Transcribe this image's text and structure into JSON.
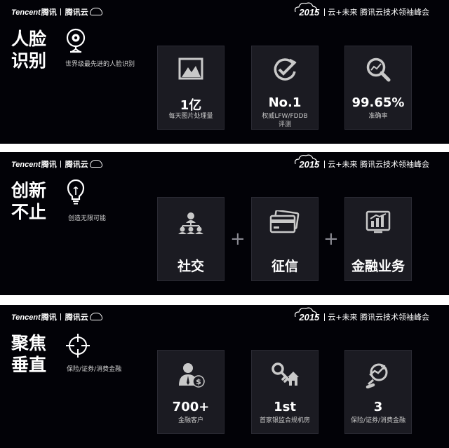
{
  "brand": {
    "tencent": "Tencent",
    "tengxun": "腾讯",
    "cloud": "腾讯云"
  },
  "event": {
    "year": "2015",
    "text": "云+未来 腾讯云技术领袖峰会"
  },
  "slides": [
    {
      "title_lines": [
        "人脸",
        "识别"
      ],
      "icon": "webcam-icon",
      "subtitle": "世界级最先进的人脸识别",
      "cards": [
        {
          "icon": "image-icon",
          "value": "1亿",
          "label": [
            "每天图片处理量"
          ]
        },
        {
          "icon": "checkmark-refresh-icon",
          "value": "No.1",
          "label": [
            "权威LFW/FDDB",
            "评测"
          ]
        },
        {
          "icon": "magnifier-chart-icon",
          "value": "99.65%",
          "label": [
            "准确率"
          ]
        }
      ]
    },
    {
      "title_lines": [
        "创新",
        "不止"
      ],
      "icon": "lightbulb-icon",
      "subtitle": "创造无限可能",
      "cards": [
        {
          "icon": "social-network-icon",
          "name": "社交"
        },
        {
          "icon": "credit-card-icon",
          "name": "征信"
        },
        {
          "icon": "financial-chart-icon",
          "name": "金融业务"
        }
      ],
      "plus": "+"
    },
    {
      "title_lines": [
        "聚焦",
        "垂直"
      ],
      "icon": "crosshair-icon",
      "subtitle": "保险/证券/消费金融",
      "cards": [
        {
          "icon": "customer-dollar-icon",
          "value": "700+",
          "label": [
            "金融客户"
          ]
        },
        {
          "icon": "key-house-icon",
          "value": "1st",
          "label": [
            "首家银监合规机房"
          ]
        },
        {
          "icon": "chart-magnifier-icon",
          "value": "3",
          "label": [
            "保险/证券/消费金融"
          ]
        }
      ]
    }
  ]
}
